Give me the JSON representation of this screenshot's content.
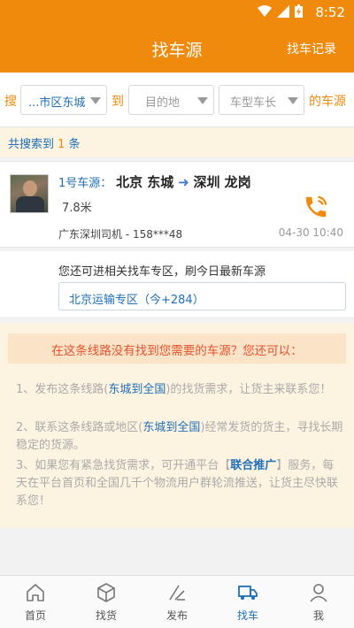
{
  "status_bar": {
    "time": "8:52"
  },
  "header": {
    "title": "找车源",
    "record_link": "找车记录"
  },
  "filter": {
    "search_label": "搜",
    "origin_value": "...市区东城",
    "to_label": "到",
    "destination_placeholder": "目的地",
    "truck_placeholder": "车型车长",
    "suffix_label": "的车源"
  },
  "result_count": {
    "prefix": "共搜索到 ",
    "count": "1",
    "suffix": " 条"
  },
  "listing": {
    "number": "1号车源：",
    "origin": "北京 东城",
    "arrow": "➜",
    "destination": "深圳 龙岗",
    "length": "7.8米",
    "driver": "广东深圳司机 - 158***48",
    "time": "04-30 10:40"
  },
  "zone": {
    "tip": "您还可进相关找车专区，刷今日最新车源",
    "button_label": "北京运输专区（今+284）"
  },
  "not_found": {
    "title": "在这条线路没有找到您需要的车源？您还可以：",
    "item1_a": "1、发布这条线路(",
    "item1_link": "东城到全国",
    "item1_b": ")的找货需求，让货主来联系您！",
    "item2_a": "2、联系这条线路或地区(",
    "item2_link": "东城到全国",
    "item2_b": ")经常发货的货主，寻找长期稳定的货源。",
    "item3_a": "3、如果您有紧急找货需求，可开通平台【",
    "item3_link": "联合推广",
    "item3_b": "】服务，每天在平台首页和全国几千个物流用户群轮流推送，让货主尽快联系您！"
  },
  "tabs": [
    {
      "label": "首页",
      "icon": "home-icon"
    },
    {
      "label": "找货",
      "icon": "package-icon"
    },
    {
      "label": "发布",
      "icon": "edit-icon"
    },
    {
      "label": "找车",
      "icon": "truck-icon",
      "active": true
    },
    {
      "label": "我",
      "icon": "person-icon"
    }
  ],
  "colors": {
    "brand": "#f08a0c",
    "link": "#1f6fb6",
    "warning": "#e5532d"
  }
}
